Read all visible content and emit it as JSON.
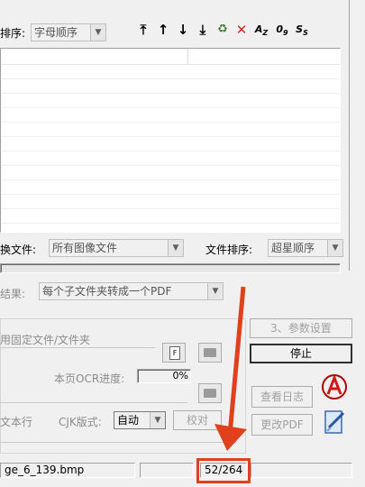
{
  "toolbar": {
    "sort_label": "排序:",
    "sort_value": "字母顺序",
    "icons": [
      "move-top-icon",
      "move-up-icon",
      "move-down-icon",
      "move-bottom-icon",
      "recycle-icon",
      "delete-icon",
      "sort-az-icon",
      "sort-09-icon",
      "sort-ss-icon"
    ]
  },
  "filter": {
    "file_type_label": "换文件:",
    "file_type_value": "所有图像文件",
    "file_sort_label": "文件排序:",
    "file_sort_value": "超星顺序"
  },
  "result": {
    "label": "结果:",
    "value": "每个子文件夹转成一个PDF"
  },
  "fixed": {
    "label": "用固定文件/文件夹"
  },
  "progress": {
    "label": "本页OCR进度:",
    "value": "0%"
  },
  "ocr": {
    "text_line_label": "文本行",
    "cjk_label": "CJK版式:",
    "cjk_value": "自动",
    "proofread_button": "校对"
  },
  "buttons": {
    "params": "3、参数设置",
    "stop": "停止",
    "view_log": "查看日志",
    "modify_pdf": "更改PDF"
  },
  "status": {
    "file": "ge_6_139.bmp",
    "page": "52/264"
  },
  "colors": {
    "highlight": "#e0401c",
    "delete": "#e02020"
  }
}
